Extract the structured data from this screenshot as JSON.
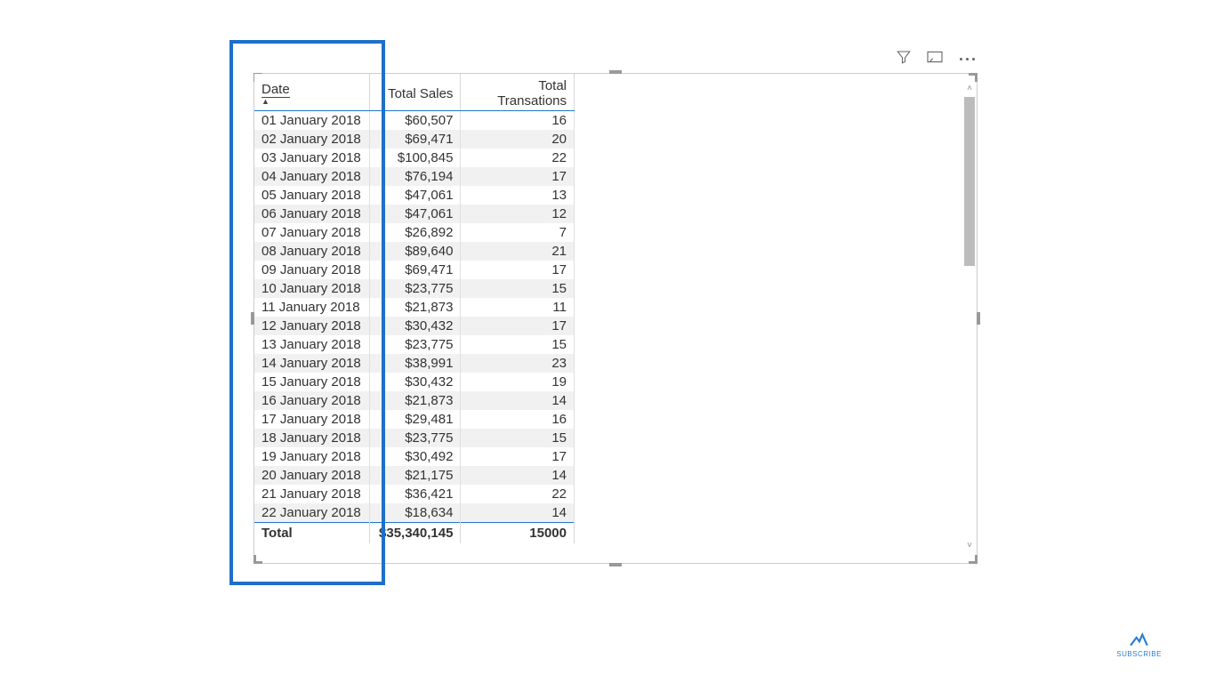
{
  "toolbar": {
    "filter_icon": "filter-icon",
    "focus_icon": "focus-mode-icon",
    "more_icon": "more-options-icon"
  },
  "table": {
    "headers": {
      "date": "Date",
      "total_sales": "Total Sales",
      "total_transactions": "Total Transations"
    },
    "sort_indicator": "▲",
    "rows": [
      {
        "date": "01 January 2018",
        "sales": "$60,507",
        "tx": "16"
      },
      {
        "date": "02 January 2018",
        "sales": "$69,471",
        "tx": "20"
      },
      {
        "date": "03 January 2018",
        "sales": "$100,845",
        "tx": "22"
      },
      {
        "date": "04 January 2018",
        "sales": "$76,194",
        "tx": "17"
      },
      {
        "date": "05 January 2018",
        "sales": "$47,061",
        "tx": "13"
      },
      {
        "date": "06 January 2018",
        "sales": "$47,061",
        "tx": "12"
      },
      {
        "date": "07 January 2018",
        "sales": "$26,892",
        "tx": "7"
      },
      {
        "date": "08 January 2018",
        "sales": "$89,640",
        "tx": "21"
      },
      {
        "date": "09 January 2018",
        "sales": "$69,471",
        "tx": "17"
      },
      {
        "date": "10 January 2018",
        "sales": "$23,775",
        "tx": "15"
      },
      {
        "date": "11 January 2018",
        "sales": "$21,873",
        "tx": "11"
      },
      {
        "date": "12 January 2018",
        "sales": "$30,432",
        "tx": "17"
      },
      {
        "date": "13 January 2018",
        "sales": "$23,775",
        "tx": "15"
      },
      {
        "date": "14 January 2018",
        "sales": "$38,991",
        "tx": "23"
      },
      {
        "date": "15 January 2018",
        "sales": "$30,432",
        "tx": "19"
      },
      {
        "date": "16 January 2018",
        "sales": "$21,873",
        "tx": "14"
      },
      {
        "date": "17 January 2018",
        "sales": "$29,481",
        "tx": "16"
      },
      {
        "date": "18 January 2018",
        "sales": "$23,775",
        "tx": "15"
      },
      {
        "date": "19 January 2018",
        "sales": "$30,492",
        "tx": "17"
      },
      {
        "date": "20 January 2018",
        "sales": "$21,175",
        "tx": "14"
      },
      {
        "date": "21 January 2018",
        "sales": "$36,421",
        "tx": "22"
      },
      {
        "date": "22 January 2018",
        "sales": "$18,634",
        "tx": "14"
      }
    ],
    "totals": {
      "label": "Total",
      "sales": "$35,340,145",
      "tx": "15000"
    }
  },
  "badge": {
    "label": "SUBSCRIBE"
  }
}
